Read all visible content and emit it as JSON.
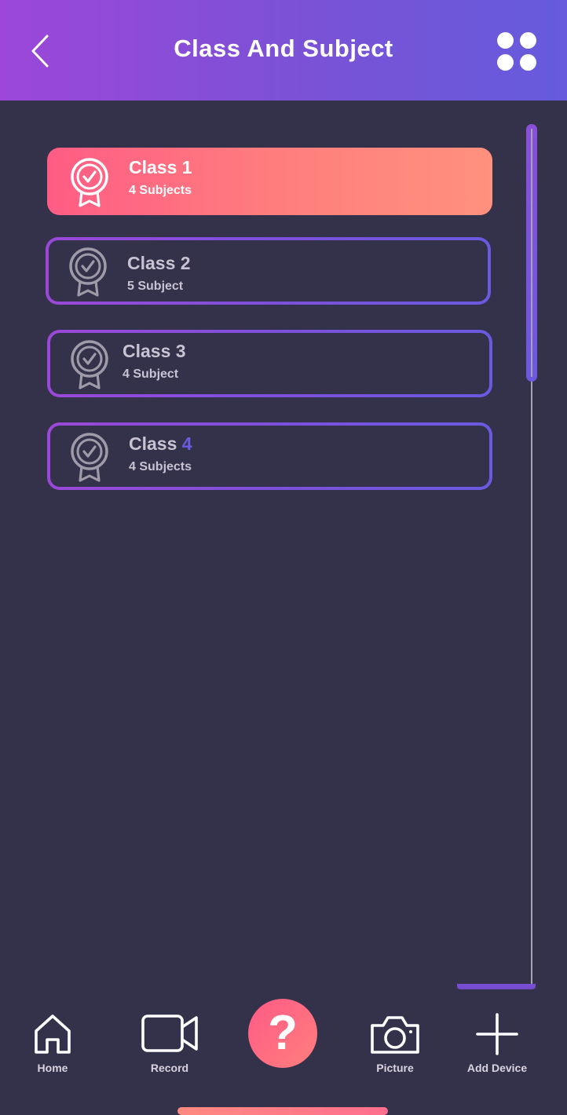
{
  "header": {
    "title": "Class And Subject",
    "back_icon": "chevron-left-icon",
    "menu_icon": "grid-dots-icon"
  },
  "classes": [
    {
      "name": "Class 1",
      "subjects": "4 Subjects",
      "selected": true
    },
    {
      "name": "Class 2",
      "subjects": "5 Subject",
      "selected": false
    },
    {
      "name": "Class 3",
      "subjects": "4 Subject",
      "selected": false
    },
    {
      "name_prefix": "Class ",
      "name_highlight": "4",
      "subjects": "4 Subjects",
      "selected": false
    }
  ],
  "nav": {
    "items": [
      {
        "label": "Home",
        "icon": "home-icon"
      },
      {
        "label": "Record",
        "icon": "video-camera-icon"
      },
      {
        "label": "?",
        "icon": "help-icon"
      },
      {
        "label": "Picture",
        "icon": "camera-icon"
      },
      {
        "label": "Add Device",
        "icon": "plus-icon"
      }
    ]
  },
  "colors": {
    "background": "#34314a",
    "header_start": "#9c47d8",
    "header_end": "#655bdc",
    "active_card_start": "#ff5c85",
    "active_card_end": "#ff917e",
    "outline_accent": "#7d50dc",
    "muted_text": "#c8c3d2"
  }
}
